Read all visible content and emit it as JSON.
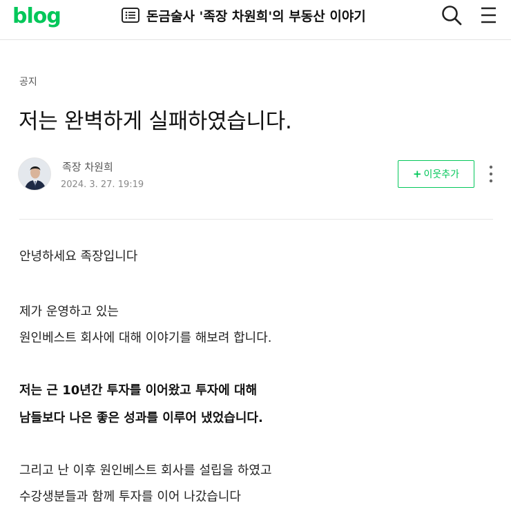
{
  "header": {
    "logo": "blog",
    "blog_title": "돈금술사 '족장 차원희'의 부동산 이야기"
  },
  "post": {
    "category": "공지",
    "title": "저는 완벽하게 실패하였습니다.",
    "author": "족장 차원희",
    "date": "2024. 3. 27. 19:19",
    "neighbor_button": "이웃추가",
    "body": [
      "안녕하세요 족장입니다",
      "제가 운영하고 있는",
      "원인베스트 회사에 대해 이야기를 해보려 합니다.",
      "저는 근 10년간 투자를 이어왔고 투자에 대해",
      "남들보다 나은 좋은 성과를 이루어 냈었습니다.",
      "그리고 난 이후 원인베스트 회사를 설립을 하였고",
      "수강생분들과 함께 투자를 이어 나갔습니다"
    ]
  },
  "colors": {
    "brand_green": "#03c75a",
    "text": "#222222",
    "muted": "#888888"
  }
}
